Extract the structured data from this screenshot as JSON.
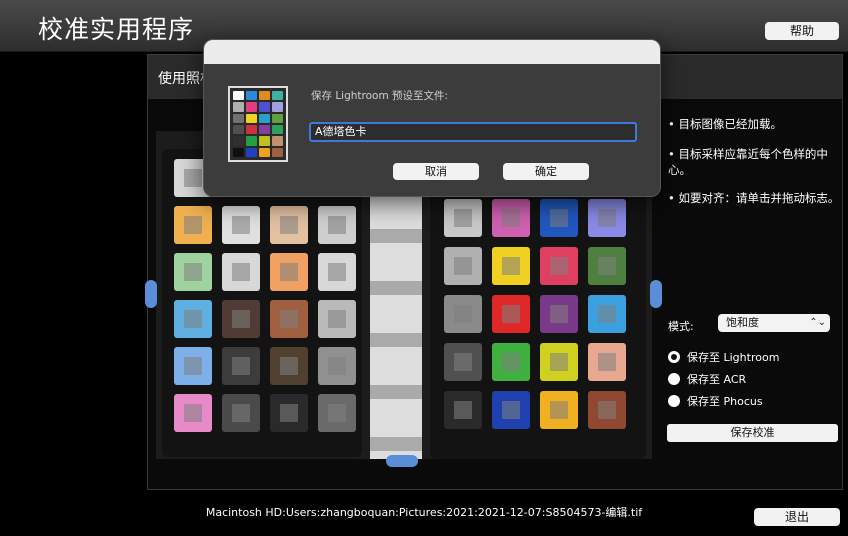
{
  "app": {
    "title": "校准实用程序",
    "help_label": "帮助"
  },
  "panel": {
    "title": "使用照相机拍摄的目标图像"
  },
  "info": {
    "line1": "• 目标图像已经加载。",
    "line2": "• 目标采样应靠近每个色样的中心。",
    "line3": "• 如要对齐：请单击并拖动标志。"
  },
  "mode": {
    "label": "模式:",
    "selected": "饱和度"
  },
  "save_options": [
    {
      "label": "保存至 Lightroom",
      "selected": true
    },
    {
      "label": "保存至 ACR",
      "selected": false
    },
    {
      "label": "保存至 Phocus",
      "selected": false
    }
  ],
  "save_calibration_label": "保存校准",
  "file_path": "Macintosh HD:Users:zhangboquan:Pictures:2021:2021-12-07:S8504573-编辑.tif",
  "quit_label": "退出",
  "dialog": {
    "prompt": "保存 Lightroom 预设至文件:",
    "input_value": "A德塔色卡",
    "cancel_label": "取消",
    "ok_label": "确定"
  },
  "colors": {
    "accent": "#3d7ad9",
    "left_patches": [
      "#d8d8d8",
      "#e8c89a",
      "#eaeaea",
      "#cfcfcf",
      "#f0b050",
      "#e0e0e0",
      "#e2c0a0",
      "#cfcfcf",
      "#9ed29e",
      "#d8d8d8",
      "#f0a060",
      "#d8d8d8",
      "#5fb0e0",
      "#503c34",
      "#a06040",
      "#bababa",
      "#7db0e8",
      "#3c3c3c",
      "#504030",
      "#909090",
      "#e88ac8",
      "#4a4a4a",
      "#2a2a2a",
      "#6a6a6a"
    ],
    "right_patches": [
      "#c8c8c8",
      "#d060b0",
      "#2058c0",
      "#8a8ae8",
      "#b0b0b0",
      "#f0d020",
      "#e04060",
      "#508040",
      "#8a8a8a",
      "#e02828",
      "#7a3a8a",
      "#3aa0e0",
      "#505050",
      "#40b040",
      "#d0d020",
      "#e8a890",
      "#2a2a2a",
      "#2040b0",
      "#f0b020",
      "#904830"
    ],
    "icon_patches": [
      "#ffffff",
      "#2a8ae0",
      "#e08a20",
      "#40b0a0",
      "#b0b0b0",
      "#e04080",
      "#5050d0",
      "#a0a0e0",
      "#707070",
      "#f0d020",
      "#2aa0d0",
      "#60a040",
      "#505050",
      "#d03040",
      "#8040a0",
      "#30a060",
      "#303030",
      "#20a040",
      "#c0c020",
      "#c09070",
      "#101010",
      "#2040c0",
      "#f0a020",
      "#a06040"
    ]
  },
  "icons": {
    "nav_left": "chevron-left-icon",
    "nav_right": "chevron-right-icon",
    "nav_down": "chevron-down-icon",
    "select": "up-down-chevron-icon"
  }
}
